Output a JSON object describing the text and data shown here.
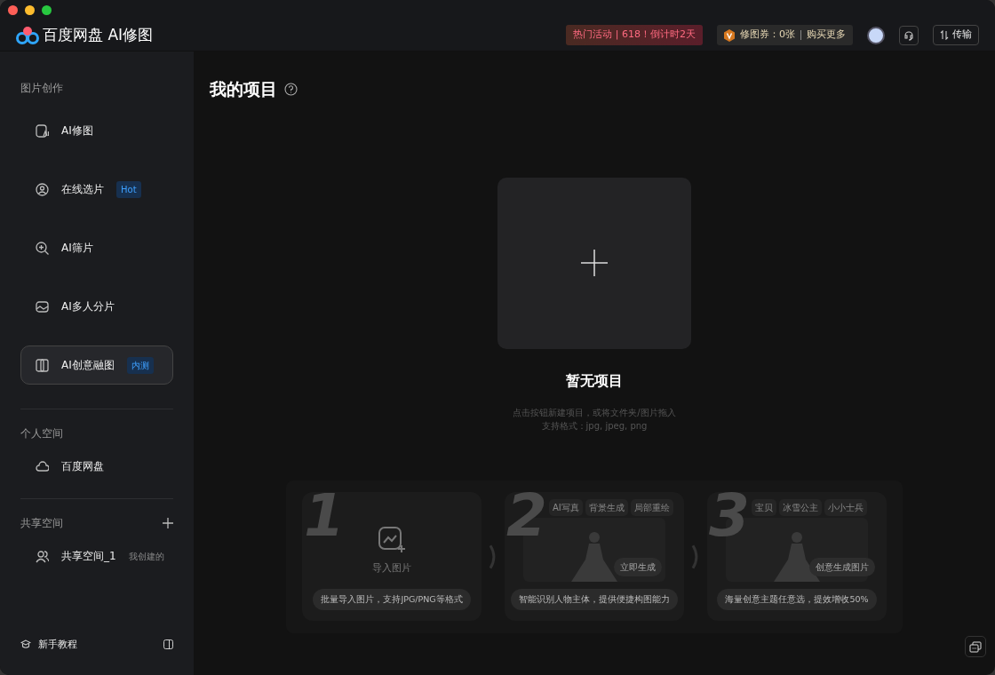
{
  "header": {
    "app_title": "百度网盘 AI修图",
    "promo": "热门活动 | 618！倒计时2天",
    "voucher": {
      "label": "修图券：0张",
      "action": "购买更多"
    },
    "transfer": "传输"
  },
  "sidebar": {
    "sections": [
      {
        "title": "图片创作",
        "items": [
          {
            "label": "AI修图",
            "selected": false
          },
          {
            "label": "在线选片",
            "badge": "Hot",
            "selected": false
          },
          {
            "label": "AI筛片",
            "selected": false
          },
          {
            "label": "AI多人分片",
            "selected": false
          },
          {
            "label": "AI创意融图",
            "badge": "内测",
            "selected": true
          }
        ]
      },
      {
        "title": "个人空间",
        "items": [
          {
            "label": "百度网盘",
            "selected": false
          }
        ]
      },
      {
        "title": "共享空间",
        "add": true,
        "items": [
          {
            "label": "共享空间_1",
            "note": "我创建的",
            "selected": false
          }
        ]
      }
    ],
    "footer": "新手教程"
  },
  "main": {
    "title": "我的项目",
    "empty_title": "暂无项目",
    "hints": [
      "点击按钮新建项目，或将文件夹/图片拖入",
      "支持格式：jpg, jpeg, png"
    ],
    "steps": [
      {
        "number": "1",
        "kind": "import",
        "label": "导入图片",
        "caption": "批量导入图片，支持JPG/PNG等格式"
      },
      {
        "number": "2",
        "kind": "generate",
        "chips": [
          "AI写真",
          "背景生成",
          "局部重绘"
        ],
        "action": "立即生成",
        "caption": "智能识别人物主体，提供便捷构图能力"
      },
      {
        "number": "3",
        "kind": "themes",
        "chips": [
          "宝贝",
          "冰雪公主",
          "小小士兵"
        ],
        "action": "创意生成图片",
        "caption": "海量创意主题任意选，提效增收50%"
      }
    ]
  }
}
